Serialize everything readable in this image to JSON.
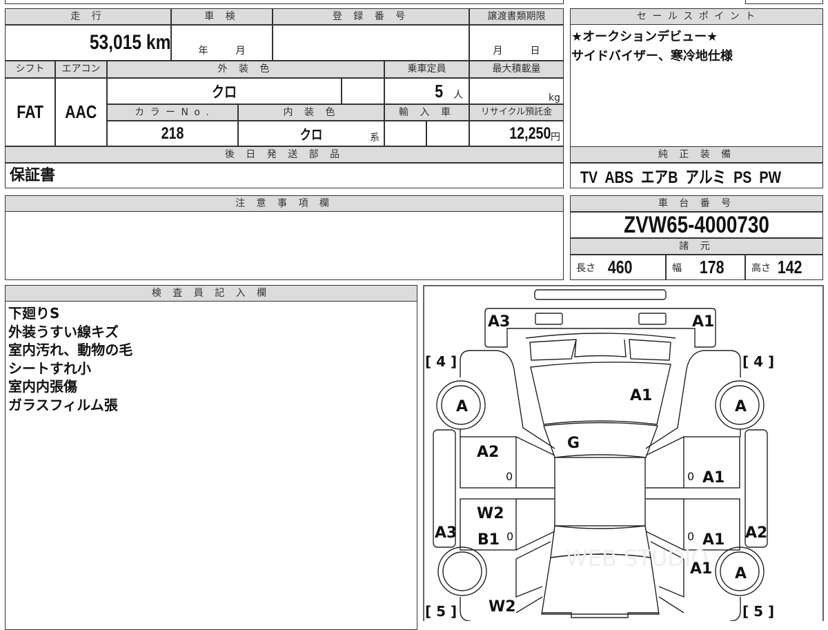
{
  "top_table": {
    "mileage": {
      "label": "走 行",
      "value": "53,015 km"
    },
    "inspection": {
      "label": "車 検",
      "year_unit": "年",
      "month_unit": "月"
    },
    "registration": {
      "label": "登 録 番 号",
      "value": ""
    },
    "transfer_deadline": {
      "label": "譲渡書類期限",
      "month_unit": "月",
      "day_unit": "日"
    },
    "shift": {
      "label": "シフト",
      "value": "FAT"
    },
    "aircon": {
      "label": "エアコン",
      "value": "AAC"
    },
    "exterior_color": {
      "label": "外 装 色",
      "value": "クロ"
    },
    "capacity": {
      "label": "乗車定員",
      "value": "5",
      "unit": "人"
    },
    "max_load": {
      "label": "最大積載量",
      "unit": "kg"
    },
    "color_no": {
      "label": "カ ラ ー N o .",
      "value": "218"
    },
    "interior_color": {
      "label": "内 装 色",
      "value": "クロ",
      "unit": "系"
    },
    "import": {
      "label": "輸 入 車"
    },
    "recycle": {
      "label": "リサイクル預託金",
      "value": "12,250",
      "unit": "円"
    },
    "later_parts": {
      "label": "後 日 発 送 部 品",
      "value": "保証書"
    }
  },
  "sales_point": {
    "label": "セ ー ル ス ポ イ ン ト",
    "lines": [
      "★オークションデビュー★",
      "サイドバイザー、寒冷地仕様"
    ]
  },
  "equipment": {
    "label": "純 正 装 備",
    "value": "TV  ABS  エアB  アルミ  PS  PW"
  },
  "notes": {
    "label": "注 意 事 項 欄",
    "value": ""
  },
  "chassis": {
    "label": "車 台 番 号",
    "value": "ZVW65-4000730"
  },
  "specs": {
    "label": "諸 元",
    "length_label": "長さ",
    "length": "460",
    "width_label": "幅",
    "width": "178",
    "height_label": "高さ",
    "height": "142"
  },
  "inspector": {
    "label": "検 査 員 記 入 欄",
    "lines": [
      "下廻りS",
      "外装うすい線キズ",
      "室内汚れ、動物の毛",
      "シートすれ小",
      "室内内張傷",
      "ガラスフィルム張"
    ]
  },
  "diagram": {
    "front_left": "A3",
    "front_right": "A1",
    "fl_tire": "[ 4 ]",
    "fr_tire": "[ 4 ]",
    "fl_wheel": "A",
    "fr_wheel": "A",
    "hood": "A1",
    "windshield": "G",
    "fl_door": "A2",
    "fl_door_mark": "0",
    "fr_door_mark": "0",
    "fr_door": "A1",
    "rl_door_top": "W2",
    "rl_door": "B1",
    "rl_door_mark": "0",
    "left_sill": "A3",
    "rr_door_mark": "0",
    "rr_door": "A1",
    "right_sill": "A2",
    "rr_fender": "A1",
    "rr_wheel": "A",
    "rl_fender": "W2",
    "rl_tire": "[ 5 ]",
    "rr_tire": "[ 5 ]",
    "watermark": "WEB STUDIO"
  }
}
